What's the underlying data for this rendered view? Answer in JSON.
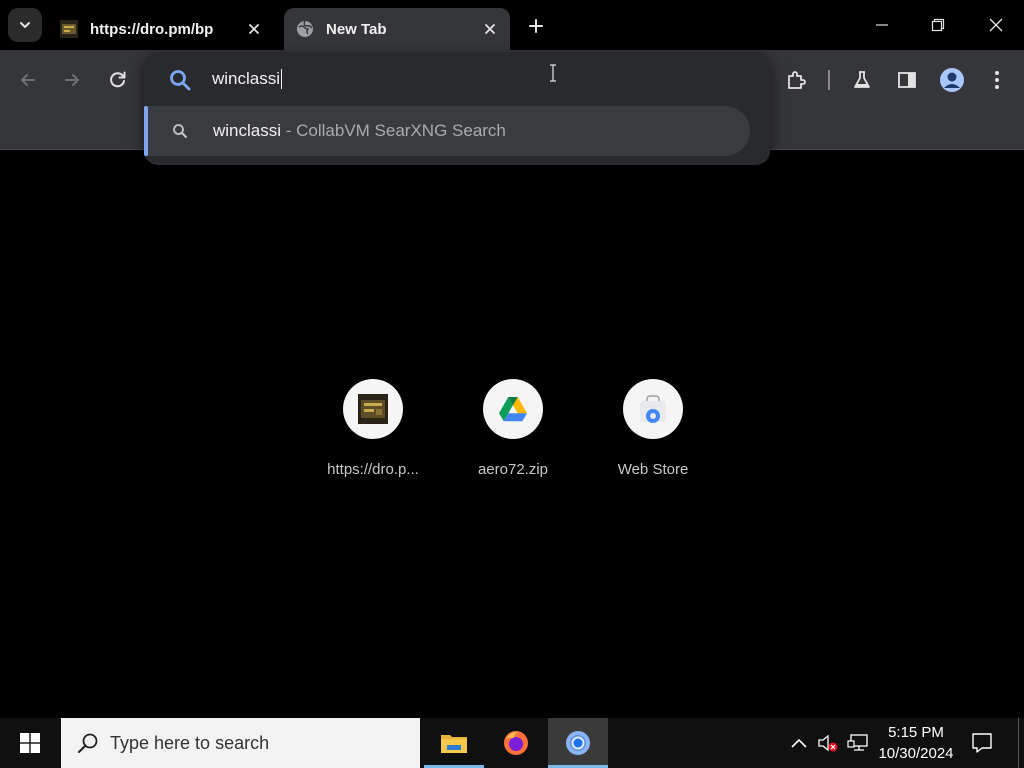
{
  "tabs": [
    {
      "title": "https://dro.pm/bp",
      "active": false,
      "favicon": "site-favicon"
    },
    {
      "title": "New Tab",
      "active": true,
      "favicon": "globe-icon"
    }
  ],
  "omnibox": {
    "value": "winclassi",
    "suggestion": {
      "query": "winclassi",
      "description": " - CollabVM SearXNG Search",
      "icon": "search-icon"
    }
  },
  "shortcuts": [
    {
      "label": "https://dro.p...",
      "icon": "site-favicon"
    },
    {
      "label": "aero72.zip",
      "icon": "google-drive-icon"
    },
    {
      "label": "Web Store",
      "icon": "web-store-icon"
    }
  ],
  "taskbar": {
    "search_placeholder": "Type here to search",
    "apps": [
      "file-explorer-icon",
      "firefox-icon",
      "chrome-icon"
    ],
    "active_app": "chrome-icon",
    "clock": {
      "time": "5:15 PM",
      "date": "10/30/2024"
    }
  },
  "colors": {
    "accent": "#7ca5f2",
    "toolbar": "#35363a",
    "omnibox": "#292a2d",
    "taskbar": "#101010"
  }
}
